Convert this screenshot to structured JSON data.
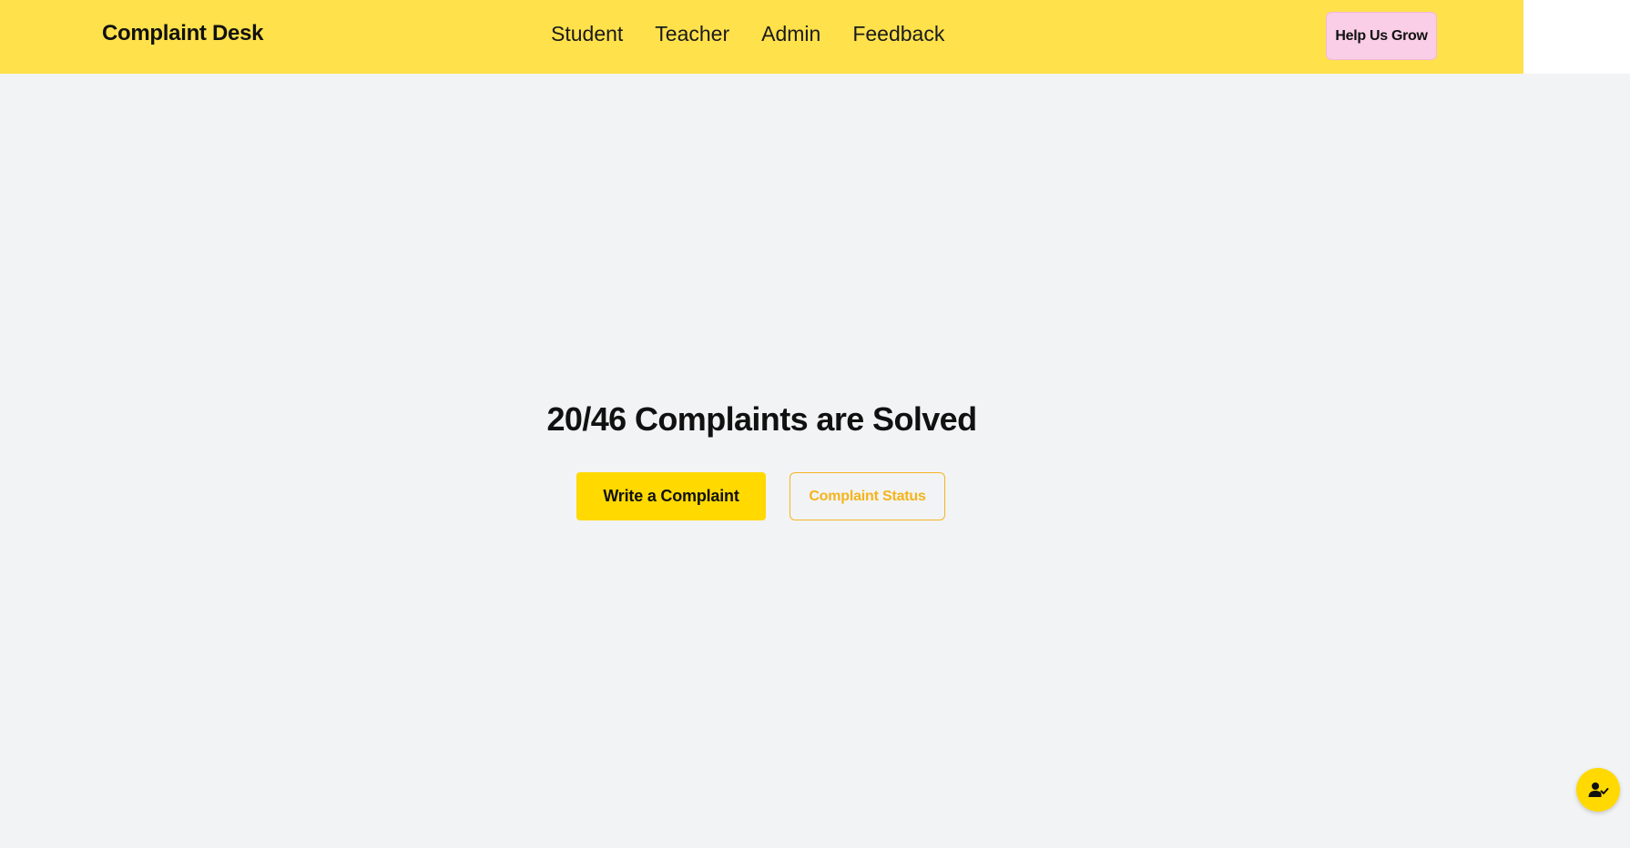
{
  "header": {
    "brand": "Complaint Desk",
    "nav": [
      {
        "label": "Student"
      },
      {
        "label": "Teacher"
      },
      {
        "label": "Admin"
      },
      {
        "label": "Feedback"
      }
    ],
    "help_button": "Help Us Grow"
  },
  "hero": {
    "title": "20/46 Complaints are Solved",
    "primary_button": "Write a Complaint",
    "secondary_button": "Complaint Status"
  },
  "fab": {
    "icon": "user-check-icon"
  },
  "colors": {
    "navbar": "#ffe14b",
    "accent": "#ffd900",
    "outline": "#f4b625",
    "help_button": "#f9cee6",
    "background": "#f2f3f4"
  }
}
